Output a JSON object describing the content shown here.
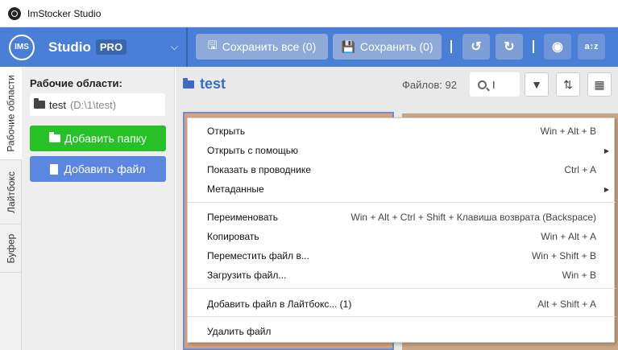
{
  "window": {
    "title": "ImStocker Studio"
  },
  "header": {
    "logo_text": "IMS",
    "brand": "Studio",
    "badge": "PRO",
    "save_all_label": "Сохранить все (0)",
    "save_label": "Сохранить (0)"
  },
  "vtabs": [
    "Рабочие области",
    "Лайтбокс",
    "Буфер"
  ],
  "sidebar": {
    "title": "Рабочие области:",
    "workspace": {
      "name": "test",
      "path": "(D:\\1\\test)"
    },
    "add_folder": "Добавить папку",
    "add_file": "Добавить файл"
  },
  "main": {
    "title": "test",
    "files_count": "Файлов: 92",
    "search_value": "I"
  },
  "context_menu": {
    "items": [
      {
        "label": "Открыть",
        "shortcut": "Win + Alt + B"
      },
      {
        "label": "Открыть с помощью",
        "shortcut": ""
      },
      {
        "label": "Показать в проводнике",
        "shortcut": "Ctrl + A"
      },
      {
        "label": "Метаданные",
        "shortcut": ""
      },
      {
        "label": "Переименовать",
        "shortcut": "Win + Alt + Ctrl + Shift + Клавиша возврата (Backspace)"
      },
      {
        "label": "Копировать",
        "shortcut": "Win + Alt + A"
      },
      {
        "label": "Переместить файл в...",
        "shortcut": "Win + Shift + B"
      },
      {
        "label": "Загрузить файл...",
        "shortcut": "Win + B"
      },
      {
        "label": "Добавить файл в Лайтбокс... (1)",
        "shortcut": "Alt + Shift + A"
      },
      {
        "label": "Удалить файл",
        "shortcut": ""
      }
    ]
  },
  "colors": {
    "header": "#4a7fd8",
    "add_folder": "#27c027",
    "add_file": "#5b87e0",
    "title_blue": "#3b6bc4"
  }
}
